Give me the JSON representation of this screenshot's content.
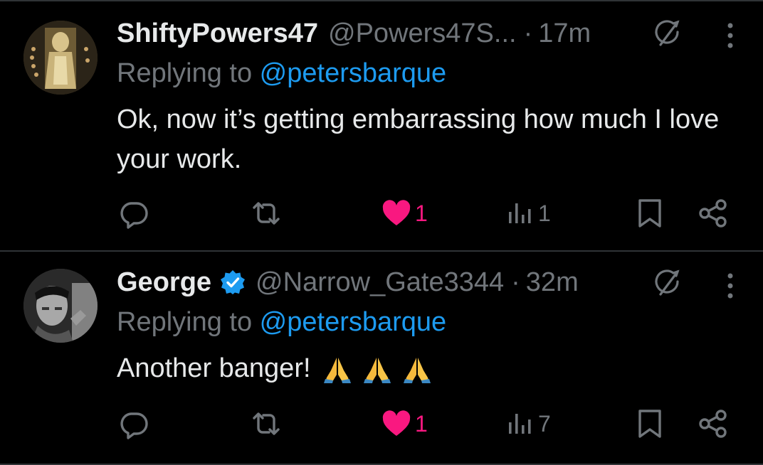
{
  "colors": {
    "background": "#000000",
    "text_primary": "#e7e9ea",
    "text_secondary": "#71767b",
    "link": "#1d9bf0",
    "like_active": "#f91880",
    "verified": "#1d9bf0",
    "divider": "#2f3336"
  },
  "tweets": [
    {
      "display_name": "ShiftyPowers47",
      "verified": false,
      "handle": "@Powers47S...",
      "separator": "·",
      "time": "17m",
      "replying_prefix": "Replying to ",
      "replying_to": "@petersbarque",
      "text": "Ok, now it’s getting embarrassing how much I love your work.",
      "emojis": [],
      "actions": {
        "reply_icon": "reply-icon",
        "retweet_icon": "retweet-icon",
        "like_icon": "heart-filled-icon",
        "like_count": "1",
        "views_icon": "views-icon",
        "views_count": "1",
        "bookmark_icon": "bookmark-icon",
        "share_icon": "share-icon"
      }
    },
    {
      "display_name": "George",
      "verified": true,
      "handle": "@Narrow_Gate3344",
      "separator": "·",
      "time": "32m",
      "replying_prefix": "Replying to ",
      "replying_to": "@petersbarque",
      "text": "Another banger!",
      "emojis": [
        "folded-hands-emoji",
        "folded-hands-emoji",
        "folded-hands-emoji"
      ],
      "actions": {
        "reply_icon": "reply-icon",
        "retweet_icon": "retweet-icon",
        "like_icon": "heart-filled-icon",
        "like_count": "1",
        "views_icon": "views-icon",
        "views_count": "7",
        "bookmark_icon": "bookmark-icon",
        "share_icon": "share-icon"
      }
    }
  ]
}
